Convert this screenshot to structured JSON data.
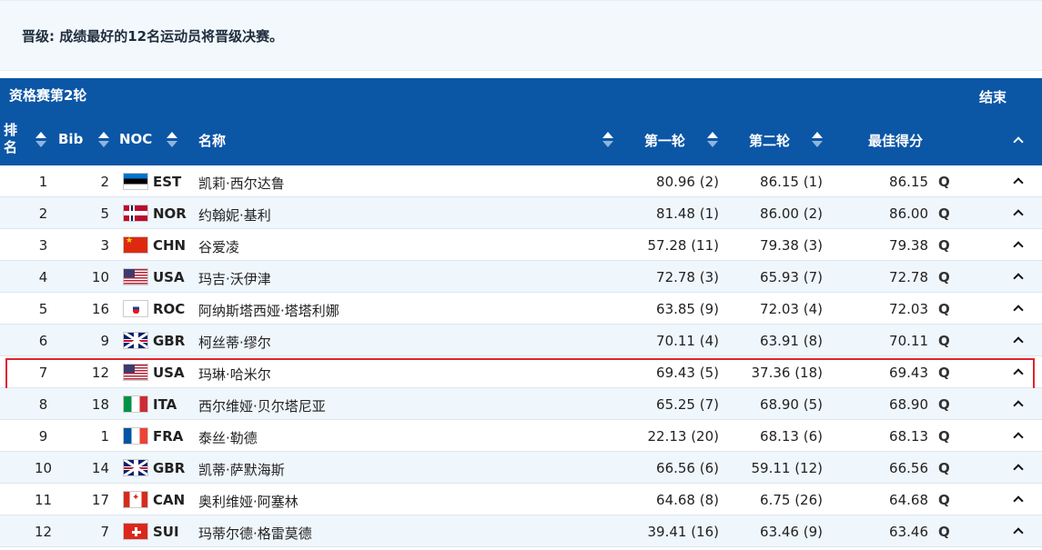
{
  "notice": "晋级: 成绩最好的12名运动员将晋级决赛。",
  "section": {
    "title": "资格赛第2轮",
    "status": "结束"
  },
  "columns": {
    "rank": "排名",
    "bib": "Bib",
    "noc": "NOC",
    "name": "名称",
    "run1": "第一轮",
    "run2": "第二轮",
    "best": "最佳得分"
  },
  "qualified_marker": "Q",
  "rows": [
    {
      "rank": "1",
      "bib": "2",
      "noc": "EST",
      "name": "凯莉·西尔达鲁",
      "run1": "80.96 (2)",
      "run2": "86.15 (1)",
      "best": "86.15",
      "flag": "f-est"
    },
    {
      "rank": "2",
      "bib": "5",
      "noc": "NOR",
      "name": "约翰妮·基利",
      "run1": "81.48 (1)",
      "run2": "86.00 (2)",
      "best": "86.00",
      "flag": "f-nor"
    },
    {
      "rank": "3",
      "bib": "3",
      "noc": "CHN",
      "name": "谷爱凌",
      "run1": "57.28 (11)",
      "run2": "79.38 (3)",
      "best": "79.38",
      "flag": "f-chn"
    },
    {
      "rank": "4",
      "bib": "10",
      "noc": "USA",
      "name": "玛吉·沃伊津",
      "run1": "72.78 (3)",
      "run2": "65.93 (7)",
      "best": "72.78",
      "flag": "f-usa"
    },
    {
      "rank": "5",
      "bib": "16",
      "noc": "ROC",
      "name": "阿纳斯塔西娅·塔塔利娜",
      "run1": "63.85 (9)",
      "run2": "72.03 (4)",
      "best": "72.03",
      "flag": "f-roc"
    },
    {
      "rank": "6",
      "bib": "9",
      "noc": "GBR",
      "name": "柯丝蒂·缪尔",
      "run1": "70.11 (4)",
      "run2": "63.91 (8)",
      "best": "70.11",
      "flag": "f-gbr"
    },
    {
      "rank": "7",
      "bib": "12",
      "noc": "USA",
      "name": "玛琳·哈米尔",
      "run1": "69.43 (5)",
      "run2": "37.36 (18)",
      "best": "69.43",
      "flag": "f-usa",
      "highlighted": true
    },
    {
      "rank": "8",
      "bib": "18",
      "noc": "ITA",
      "name": "西尔维娅·贝尔塔尼亚",
      "run1": "65.25 (7)",
      "run2": "68.90 (5)",
      "best": "68.90",
      "flag": "f-ita"
    },
    {
      "rank": "9",
      "bib": "1",
      "noc": "FRA",
      "name": "泰丝·勒德",
      "run1": "22.13 (20)",
      "run2": "68.13 (6)",
      "best": "68.13",
      "flag": "f-fra"
    },
    {
      "rank": "10",
      "bib": "14",
      "noc": "GBR",
      "name": "凯蒂·萨默海斯",
      "run1": "66.56 (6)",
      "run2": "59.11 (12)",
      "best": "66.56",
      "flag": "f-gbr"
    },
    {
      "rank": "11",
      "bib": "17",
      "noc": "CAN",
      "name": "奥利维娅·阿塞林",
      "run1": "64.68 (8)",
      "run2": "6.75 (26)",
      "best": "64.68",
      "flag": "f-can"
    },
    {
      "rank": "12",
      "bib": "7",
      "noc": "SUI",
      "name": "玛蒂尔德·格雷莫德",
      "run1": "39.41 (16)",
      "run2": "63.46 (9)",
      "best": "63.46",
      "flag": "f-sui"
    }
  ]
}
